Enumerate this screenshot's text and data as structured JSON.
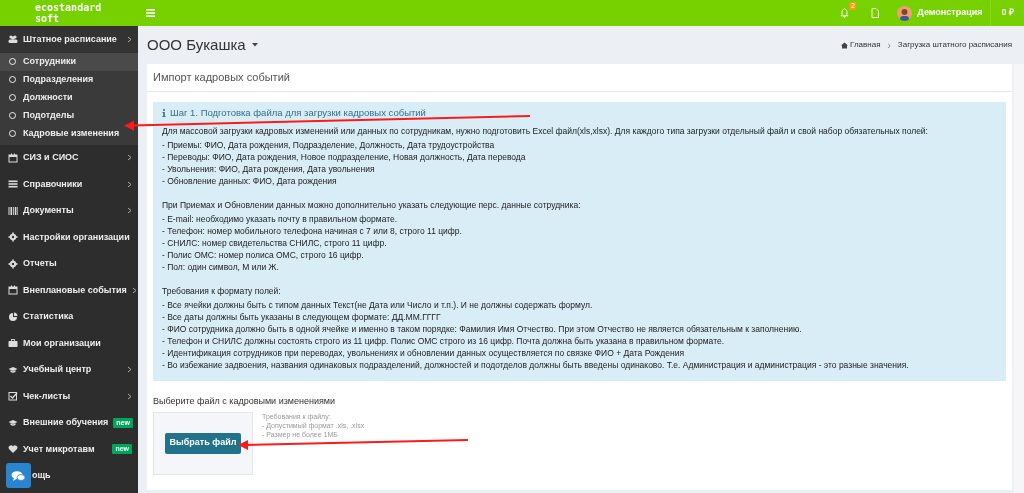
{
  "topbar": {
    "logo": [
      "ecostandard",
      "soft"
    ],
    "notifications_count": "2",
    "user": "Демонстрация",
    "balance": "0 ₽"
  },
  "sidebar": {
    "items": [
      {
        "label": "Штатное расписание",
        "expanded": true,
        "has_arrow": true,
        "children": [
          {
            "label": "Сотрудники",
            "selected": true
          },
          {
            "label": "Подразделения",
            "selected": false
          },
          {
            "label": "Должности",
            "selected": false
          },
          {
            "label": "Подотделы",
            "selected": false
          },
          {
            "label": "Кадровые изменения",
            "selected": false
          }
        ]
      },
      {
        "label": "СИЗ и СИОС",
        "expanded": false,
        "has_arrow": true
      },
      {
        "label": "Справочники",
        "expanded": false,
        "has_arrow": true
      },
      {
        "label": "Документы",
        "expanded": false,
        "has_arrow": true
      },
      {
        "label": "Настройки организации",
        "has_arrow": false
      },
      {
        "label": "Отчеты",
        "has_arrow": false
      },
      {
        "label": "Внеплановые события",
        "expanded": false,
        "has_arrow": true
      },
      {
        "label": "Статистика",
        "has_arrow": false
      },
      {
        "label": "Мои организации",
        "has_arrow": false
      },
      {
        "label": "Учебный центр",
        "expanded": false,
        "has_arrow": true
      },
      {
        "label": "Чек-листы",
        "expanded": false,
        "has_arrow": true
      },
      {
        "label": "Внешние обучения",
        "has_arrow": false,
        "badge": "new"
      },
      {
        "label": "Учет микротавм",
        "has_arrow": false,
        "badge": "new"
      },
      {
        "label": "ощь",
        "has_arrow": false
      }
    ]
  },
  "page": {
    "organization": "ООО Букашка",
    "breadcrumb": [
      "Главная",
      "Загрузка штатного расписания"
    ],
    "breadcrumb_separator": "›"
  },
  "panel": {
    "title": "Импорт кадровых событий",
    "info": {
      "heading": "Шаг 1. Подготовка файла для загрузки кадровых событий",
      "blocks": [
        {
          "intro": "Для массовой загрузки кадровых изменений или данных по сотрудникам, нужно подготовить Excel файл(xls,xlsx). Для каждого типа загрузки отдельный файл и свой набор обязательных полей:",
          "lines": [
            "- Приемы: ФИО, Дата рождения, Подразделение, Должность, Дата трудоустройства",
            "- Переводы: ФИО, Дата рождения, Новое подразделение, Новая должность, Дата перевода",
            "- Увольнения: ФИО, Дата рождения, Дата увольнения",
            "- Обновление данных: ФИО, Дата рождения"
          ]
        },
        {
          "intro": "При Приемах и Обновлении данных можно дополнительно указать следующие перс. данные сотрудника:",
          "lines": [
            "- E-mail: необходимо указать почту в правильном формате.",
            "- Телефон: номер мобильного телефона начиная с 7 или 8, строго 11 цифр.",
            "- СНИЛС: номер свидетельства СНИЛС, строго 11 цифр.",
            "- Полис ОМС: номер полиса ОМС, строго 16 цифр.",
            "- Пол: один символ, М или Ж."
          ]
        },
        {
          "intro": "Требования к формату полей:",
          "lines": [
            "- Все ячейки должны быть с типом данных Текст(не Дата или Число и т.п.). И не должны содержать формул.",
            "- Все даты должны быть указаны в следующем формате: ДД.ММ.ГГГГ",
            "- ФИО сотрудника должно быть в одной ячейке и именно в таком порядке: Фамилия Имя Отчество. При этом Отчество не является обязательным к заполнению.",
            "- Телефон и СНИЛС должны состоять строго из 11 цифр. Полис ОМС строго из 16 цифр. Почта должна быть указана в правильном формате.",
            "- Идентификация сотрудников при переводах, увольнениях и обновлении данных осуществляется по связке ФИО + Дата Рождения",
            "- Во избежание задвоения, названия одинаковых подразделений, должностей и подотделов должны быть введены одинаково. Т.е. Администрация и администрация - это разные значения."
          ]
        }
      ]
    },
    "file_label": "Выберите файл с кадровыми изменениями",
    "file_button": "Выбрать файл",
    "file_requirements": [
      "Требования к файлу:",
      "- Допустимый формат .xls, .xlsx",
      "- Размер не более 1МБ"
    ]
  }
}
